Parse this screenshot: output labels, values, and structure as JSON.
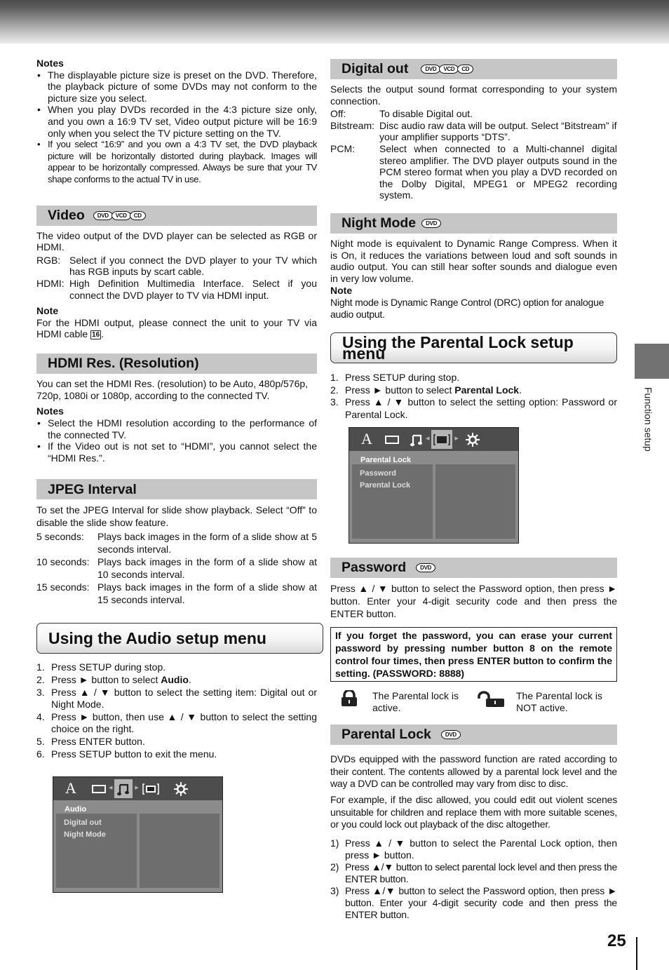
{
  "page": {
    "number": "25",
    "side_tab": "Function setup"
  },
  "left": {
    "notes": {
      "title": "Notes",
      "items": [
        "The displayable picture size is preset on the DVD. Therefore, the playback picture of some DVDs may not conform to the picture size you select.",
        "When you play DVDs recorded in the 4:3 picture size only, and you own a 16:9 TV set, Video output picture will be 16:9 only when you select the TV picture setting on the TV.",
        "If you select “16:9” and you own a 4:3 TV set, the DVD playback picture will be horizontally distorted during playback. Images will appear to be horizontally compressed. Always be sure that your TV shape conforms to the actual TV in use."
      ]
    },
    "video": {
      "title": "Video",
      "badges": [
        "DVD",
        "VCD",
        "CD"
      ],
      "intro": "The video output of the DVD player can be selected as RGB or HDMI.",
      "defs": [
        {
          "term": "RGB:",
          "desc": "Select if you connect the DVD player to your TV which has RGB inputs by scart cable."
        },
        {
          "term": "HDMI:",
          "desc": "High Definition Multimedia Interface. Select if you connect the DVD player to TV via HDMI input."
        }
      ],
      "note_title": "Note",
      "note_text": "For the HDMI output, please connect the unit to your TV via HDMI cable",
      "note_ref": "16",
      "note_end": "."
    },
    "hdmi_res": {
      "title": "HDMI Res. (Resolution)",
      "intro": "You can set the HDMI Res. (resolution) to be Auto, 480p/576p, 720p, 1080i or 1080p, according to the connected TV.",
      "notes_title": "Notes",
      "notes": [
        "Select the HDMI resolution according to the performance of the connected TV.",
        "If the Video out is not set to “HDMI”, you cannot select the “HDMI Res.”."
      ]
    },
    "jpeg": {
      "title": "JPEG Interval",
      "intro": "To set the JPEG Interval for slide show playback. Select “Off” to disable the slide show feature.",
      "defs": [
        {
          "term": "5 seconds:",
          "desc": "Plays back images in the form of a slide show at 5 seconds interval."
        },
        {
          "term": "10 seconds:",
          "desc": "Plays back images in the form of a slide show at 10 seconds interval."
        },
        {
          "term": "15 seconds:",
          "desc": "Plays back images in the form of a slide show at 15 seconds interval."
        }
      ]
    },
    "audio_menu": {
      "title": "Using the Audio setup menu",
      "steps": [
        {
          "num": "1.",
          "pre": "Press SETUP during stop.",
          "bold": "",
          "post": ""
        },
        {
          "num": "2.",
          "pre": "Press ► button to select ",
          "bold": "Audio",
          "post": "."
        },
        {
          "num": "3.",
          "pre": "Press ▲ / ▼ button to select the setting item: Digital out or Night Mode.",
          "bold": "",
          "post": ""
        },
        {
          "num": "4.",
          "pre": "Press ► button, then use ▲ / ▼ button to select the setting choice on the right.",
          "bold": "",
          "post": ""
        },
        {
          "num": "5.",
          "pre": "Press ENTER button.",
          "bold": "",
          "post": ""
        },
        {
          "num": "6.",
          "pre": "Press SETUP button to exit the menu.",
          "bold": "",
          "post": ""
        }
      ],
      "osd": {
        "icons": [
          "A",
          "▭",
          "♫",
          "[▬]",
          "☼"
        ],
        "selected_index": 2,
        "label": "Audio",
        "items": [
          "Digital out",
          "Night Mode"
        ]
      }
    }
  },
  "right": {
    "digital_out": {
      "title": "Digital out",
      "badges": [
        "DVD",
        "VCD",
        "CD"
      ],
      "intro": "Selects the output sound format corresponding to your system connection.",
      "defs": [
        {
          "term": "Off:",
          "desc": "To disable Digital out."
        },
        {
          "term": "Bitstream:",
          "desc": "Disc audio raw data will be output. Select “Bitstream” if your amplifier supports “DTS”."
        },
        {
          "term": "PCM:",
          "desc": "Select when connected to a Multi-channel digital stereo amplifier. The DVD player outputs sound in the PCM stereo format when you play a DVD recorded on the Dolby Digital, MPEG1 or MPEG2 recording system."
        }
      ]
    },
    "night_mode": {
      "title": "Night Mode",
      "badges": [
        "DVD"
      ],
      "intro": "Night mode is equivalent to Dynamic Range Compress. When it is On, it reduces the variations between loud and soft sounds in audio output. You can still hear softer sounds and dialogue even in very low volume.",
      "note_title": "Note",
      "note_text": "Night mode is Dynamic Range Control (DRC) option for analogue audio output."
    },
    "parental_menu": {
      "title": "Using the Parental Lock setup menu",
      "steps": [
        {
          "num": "1.",
          "pre": "Press SETUP during stop.",
          "bold": "",
          "post": ""
        },
        {
          "num": "2.",
          "pre": "Press ► button to select ",
          "bold": "Parental Lock",
          "post": "."
        },
        {
          "num": "3.",
          "pre": "Press ▲ / ▼ button to select the setting option: Password or Parental Lock.",
          "bold": "",
          "post": ""
        }
      ],
      "osd": {
        "icons": [
          "A",
          "▭",
          "♫",
          "[▬]",
          "☼"
        ],
        "selected_index": 3,
        "label": "Parental Lock",
        "items": [
          "Password",
          "Parental Lock"
        ]
      }
    },
    "password": {
      "title": "Password",
      "badges": [
        "DVD"
      ],
      "intro": "Press ▲ / ▼ button to select the Password option, then press ► button. Enter your 4-digit security code and then press the ENTER button.",
      "warning": "If you forget the password, you can erase your current password by pressing number button 8 on the remote control four times, then press ENTER button to confirm the setting. (PASSWORD: 8888)",
      "lock_active": "The Parental lock is active.",
      "lock_inactive": "The Parental lock is NOT active."
    },
    "parental_lock": {
      "title": "Parental Lock",
      "badges": [
        "DVD"
      ],
      "para1": "DVDs equipped with the password function are rated according to their content. The contents allowed by a parental lock level and the way a DVD can be controlled may vary from disc to disc.",
      "para2": "For example, if the disc allowed, you could edit out violent scenes unsuitable for children and replace them with more suitable scenes, or you could lock out playback of the disc altogether.",
      "steps": [
        {
          "num": "1)",
          "text": "Press ▲ / ▼ button to select the Parental Lock option, then press ► button."
        },
        {
          "num": "2)",
          "text": "Press ▲/▼ button to select parental lock level and then press the ENTER button."
        },
        {
          "num": "3)",
          "text": "Press ▲/▼ button to select the Password option, then press ► button. Enter your 4-digit security code and then press the ENTER button."
        }
      ]
    }
  }
}
